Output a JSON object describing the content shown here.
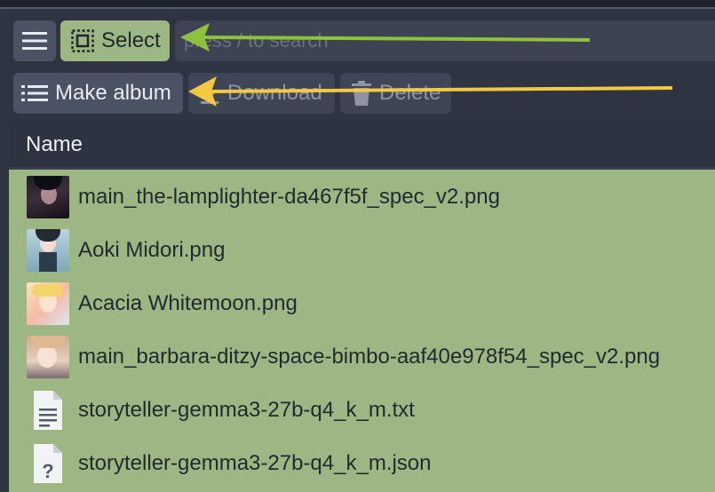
{
  "toolbar": {
    "menu_icon": "hamburger-icon",
    "select_label": "Select",
    "search_placeholder": "press / to search",
    "make_album_label": "Make album",
    "download_label": "Download",
    "delete_label": "Delete"
  },
  "table": {
    "header": "Name",
    "rows": [
      {
        "name": "main_the-lamplighter-da467f5f_spec_v2.png",
        "icon": "image-thumbnail"
      },
      {
        "name": "Aoki Midori.png",
        "icon": "image-thumbnail"
      },
      {
        "name": "Acacia Whitemoon.png",
        "icon": "image-thumbnail"
      },
      {
        "name": "main_barbara-ditzy-space-bimbo-aaf40e978f54_spec_v2.png",
        "icon": "image-thumbnail"
      },
      {
        "name": "storyteller-gemma3-27b-q4_k_m.txt",
        "icon": "text-file-icon"
      },
      {
        "name": "storyteller-gemma3-27b-q4_k_m.json",
        "icon": "unknown-file-icon"
      }
    ]
  },
  "colors": {
    "selected": "#9cb783",
    "button": "#4b5264",
    "background": "#2f3442",
    "green_arrow": "#8fc13b",
    "yellow_arrow": "#f5c842"
  }
}
